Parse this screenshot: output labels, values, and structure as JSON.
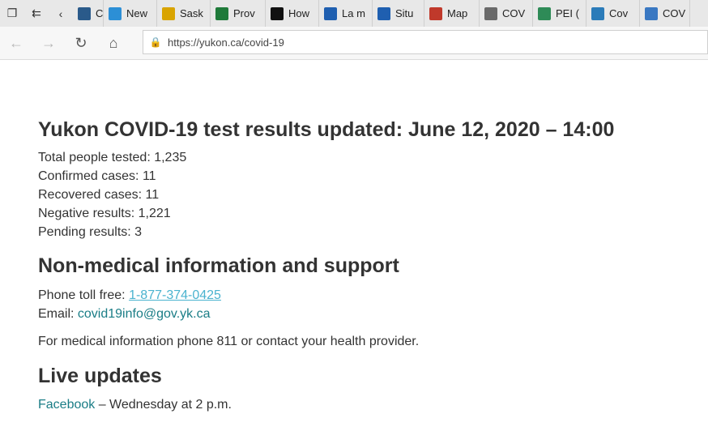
{
  "browser": {
    "tabs": [
      {
        "label": "Case",
        "icon": "page-icon",
        "color": "#2a5a8a"
      },
      {
        "label": "New",
        "icon": "chart-icon",
        "color": "#2c8fd6"
      },
      {
        "label": "Sask",
        "icon": "wheat-icon",
        "color": "#d9a400"
      },
      {
        "label": "Prov",
        "icon": "flag-icon",
        "color": "#1f7a3a"
      },
      {
        "label": "How",
        "icon": "shield-icon",
        "color": "#111111"
      },
      {
        "label": "La m",
        "icon": "fleur-icon",
        "color": "#1f5fb0"
      },
      {
        "label": "Situ",
        "icon": "fleur-icon",
        "color": "#1f5fb0"
      },
      {
        "label": "Map",
        "icon": "map-icon",
        "color": "#c0392b"
      },
      {
        "label": "COV",
        "icon": "doc-icon",
        "color": "#6a6a6a"
      },
      {
        "label": "PEI (",
        "icon": "island-icon",
        "color": "#2e8b57"
      },
      {
        "label": "Cov",
        "icon": "globe-icon",
        "color": "#2b7bb9"
      },
      {
        "label": "COV",
        "icon": "crest-icon",
        "color": "#3a78c2"
      }
    ],
    "url": "https://yukon.ca/covid-19"
  },
  "page": {
    "title": "Yukon COVID-19 test results updated: June 12, 2020 – 14:00",
    "stats": [
      "Total people tested: 1,235",
      "Confirmed cases: 11",
      "Recovered cases: 11",
      "Negative results: 1,221",
      "Pending results: 3"
    ],
    "support_heading": "Non-medical information and support",
    "phone_label": "Phone toll free: ",
    "phone_number": "1-877-374-0425",
    "email_label": "Email: ",
    "email_address": "covid19info@gov.yk.ca",
    "medical_note": "For medical information phone 811 or contact your health provider.",
    "live_heading": "Live updates",
    "facebook_link": "Facebook",
    "facebook_schedule": " – Wednesday at 2 p.m."
  }
}
